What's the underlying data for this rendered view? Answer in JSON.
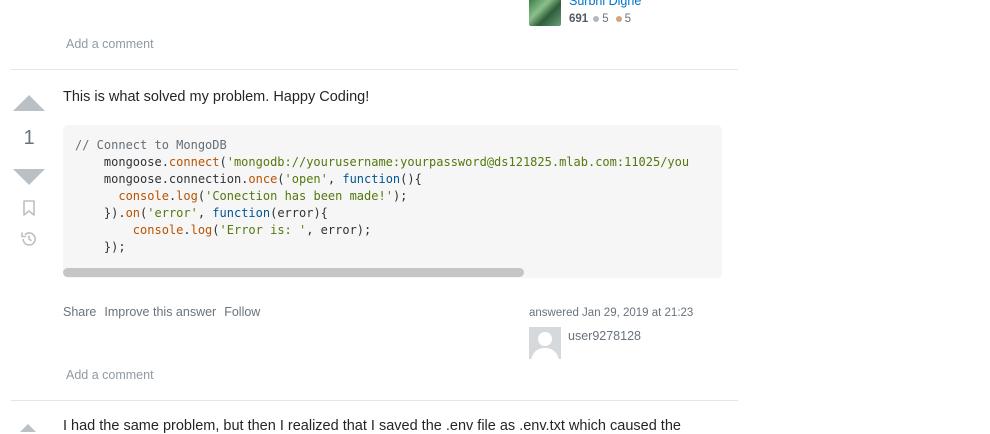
{
  "top_user": {
    "name": "Surbhi Digne",
    "reputation": "691",
    "silver_badges": "5",
    "bronze_badges": "5"
  },
  "add_comment_label": "Add a comment",
  "answer": {
    "votes": "1",
    "text": "This is what solved my problem. Happy Coding!",
    "code_lines": [
      "// Connect to MongoDB",
      "    mongoose.connect('mongodb://yourusername:yourpassword@ds121825.mlab.com:11025/you",
      "    mongoose.connection.once('open', function(){",
      "      console.log('Conection has been made!');",
      "    }).on('error', function(error){",
      "        console.log('Error is: ', error);",
      "    });"
    ],
    "scroll_fraction_visible": 0.7,
    "actions": {
      "share": "Share",
      "improve": "Improve this answer",
      "follow": "Follow"
    },
    "answered": "answered Jan 29, 2019 at 21:23",
    "user_name": "user9278128"
  },
  "next_answer_text": "I had the same problem, but then I realized that I saved the .env file as .env.txt which caused the",
  "colors": {
    "link": "#0074cc",
    "muted": "#6a737c",
    "divider": "#e3e6e8",
    "code_bg": "#f6f6f6",
    "vote_arrow": "#bbc0c4"
  }
}
